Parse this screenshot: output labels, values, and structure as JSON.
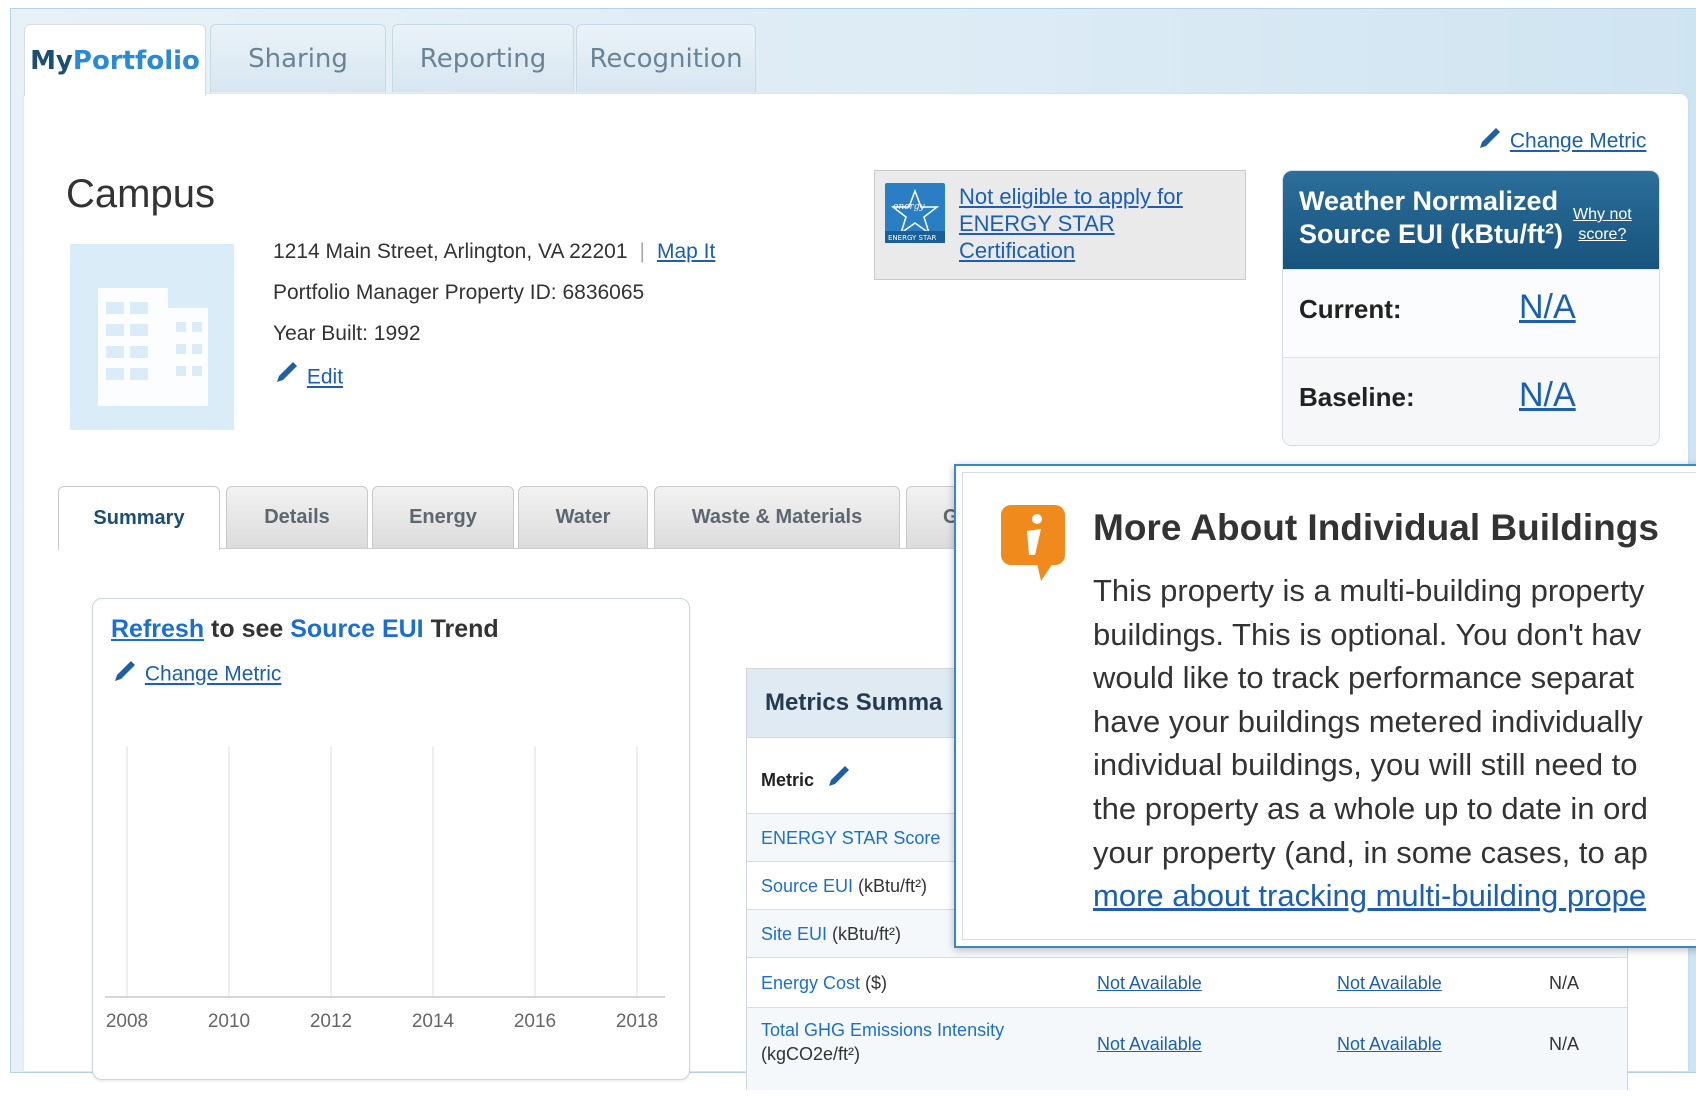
{
  "top_tabs": [
    {
      "label_prefix": "My",
      "label_main": "Portfolio"
    },
    {
      "label": "Sharing"
    },
    {
      "label": "Reporting"
    },
    {
      "label": "Recognition"
    }
  ],
  "change_metric_label": "Change Metric",
  "property": {
    "name": "Campus",
    "address": "1214 Main Street, Arlington, VA 22201",
    "separator": "|",
    "map_link": "Map It",
    "id_line": "Portfolio Manager Property ID: 6836065",
    "year_built": "Year Built: 1992",
    "edit_label": "Edit"
  },
  "energy_star": {
    "logo_text": "energy",
    "logo_label": "ENERGY STAR",
    "line1": "Not eligible to apply for",
    "line2": "ENERGY STAR",
    "line3": "Certification"
  },
  "score_card": {
    "title_line1": "Weather Normalized",
    "title_line2": "Source EUI (kBtu/ft²)",
    "why_line1": "Why not",
    "why_line2": "score?",
    "rows": [
      {
        "label": "Current:",
        "value": "N/A"
      },
      {
        "label": "Baseline:",
        "value": "N/A"
      }
    ]
  },
  "sub_tabs": [
    "Summary",
    "Details",
    "Energy",
    "Water",
    "Waste & Materials",
    "G"
  ],
  "trend_chart": {
    "refresh": "Refresh",
    "middle": " to see ",
    "metric": "Source EUI",
    "suffix": " Trend",
    "change_metric": "Change Metric"
  },
  "chart_data": {
    "type": "line",
    "x_ticks": [
      "2008",
      "2010",
      "2012",
      "2014",
      "2016",
      "2018"
    ],
    "series": [],
    "grid": "vertical"
  },
  "metrics_summary": {
    "title": "Metrics Summa",
    "metric_header": "Metric",
    "rows": [
      {
        "name": "ENERGY STAR Score",
        "unit": "",
        "v1": "",
        "v2": "",
        "v3": ""
      },
      {
        "name": "Source EUI",
        "unit": " (kBtu/ft²)",
        "v1": "",
        "v2": "",
        "v3": ""
      },
      {
        "name": "Site EUI",
        "unit": " (kBtu/ft²)",
        "v1": "",
        "v2": "",
        "v3": ""
      },
      {
        "name": "Energy Cost",
        "unit": " ($)",
        "v1": "Not Available",
        "v2": "Not Available",
        "v3": "N/A"
      },
      {
        "name": "Total GHG Emissions Intensity",
        "unit": "(kgCO2e/ft²)",
        "v1": "Not Available",
        "v2": "Not Available",
        "v3": "N/A"
      }
    ]
  },
  "popup": {
    "title": "More About Individual Buildings",
    "lines": [
      "This property is a multi-building property",
      "buildings. This is optional. You don't hav",
      "would like to track performance separat",
      "have your buildings metered individually",
      "individual buildings, you will still need to",
      "the property as a whole up to date in ord",
      "your property (and, in some cases, to ap"
    ],
    "link_text": "more about tracking multi-building prope"
  },
  "colors": {
    "accent_blue": "#1a5fb4",
    "header_blue": "#17537d",
    "info_orange": "#f08a1c"
  }
}
